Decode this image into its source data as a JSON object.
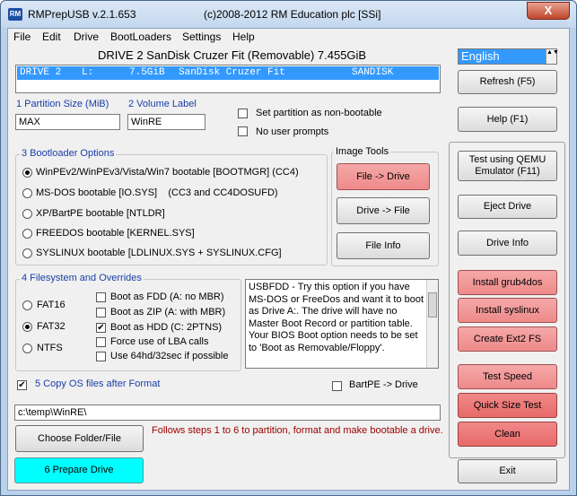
{
  "window": {
    "title_left": "RMPrepUSB v.2.1.653",
    "title_right": "(c)2008-2012 RM Education plc [SSi]",
    "icon": "RM",
    "close_label": "X"
  },
  "menu": [
    "File",
    "Edit",
    "Drive",
    "BootLoaders",
    "Settings",
    "Help"
  ],
  "drive_title": "DRIVE 2  SanDisk Cruzer Fit  (Removable) 7.455GiB",
  "drive_row": {
    "drive": "DRIVE 2",
    "letter": "L:",
    "size": "7.5GiB",
    "name": "SanDisk Cruzer Fit",
    "vendor": "SANDISK"
  },
  "language": {
    "value": "English",
    "spin": "▲▼"
  },
  "partition": {
    "size_label": "1 Partition Size (MiB)",
    "size_value": "MAX",
    "volume_label": "2 Volume Label",
    "volume_value": "WinRE",
    "non_bootable": "Set partition as non-bootable",
    "no_prompts": "No user prompts"
  },
  "bootloader": {
    "title": "3 Bootloader Options",
    "options": [
      "WinPEv2/WinPEv3/Vista/Win7 bootable [BOOTMGR] (CC4)",
      "MS-DOS bootable [IO.SYS]    (CC3 and CC4DOSUFD)",
      "XP/BartPE bootable [NTLDR]",
      "FREEDOS bootable [KERNEL.SYS]",
      "SYSLINUX bootable [LDLINUX.SYS + SYSLINUX.CFG]"
    ],
    "selected": 0
  },
  "image_tools": {
    "title": "Image Tools",
    "file_to_drive": "File -> Drive",
    "drive_to_file": "Drive -> File",
    "file_info": "File Info"
  },
  "filesystem": {
    "title": "4 Filesystem and Overrides",
    "fs": [
      "FAT16",
      "FAT32",
      "NTFS"
    ],
    "selected": 1,
    "overrides": [
      {
        "label": "Boot as FDD (A: no MBR)",
        "checked": false
      },
      {
        "label": "Boot as ZIP (A: with MBR)",
        "checked": false
      },
      {
        "label": "Boot as HDD (C: 2PTNS)",
        "checked": true
      },
      {
        "label": "Force use of LBA calls",
        "checked": false
      },
      {
        "label": "Use 64hd/32sec if possible",
        "checked": false
      }
    ]
  },
  "info_text": "USBFDD - Try this option if you have MS-DOS or FreeDos and want it to boot as Drive A:. The drive will have no Master Boot Record or partition table. Your BIOS Boot option needs to be set to 'Boot as Removable/Floppy'.",
  "copy_os": {
    "label": "5 Copy OS files after Format",
    "checked": true
  },
  "bartpe": {
    "label": "BartPE -> Drive",
    "checked": false
  },
  "path": {
    "value": "c:\\temp\\WinRE\\"
  },
  "choose_folder": "Choose Folder/File",
  "hint": "Follows steps 1 to 6 to partition, format and make bootable a drive.",
  "prepare_drive": "6 Prepare Drive",
  "side_buttons": {
    "refresh": "Refresh (F5)",
    "help": "Help (F1)",
    "qemu": "Test using QEMU Emulator (F11)",
    "eject": "Eject Drive",
    "drive_info": "Drive Info",
    "grub4dos": "Install grub4dos",
    "syslinux": "Install syslinux",
    "ext2": "Create Ext2 FS",
    "test_speed": "Test Speed",
    "quick_size": "Quick Size Test",
    "clean": "Clean",
    "exit": "Exit"
  }
}
